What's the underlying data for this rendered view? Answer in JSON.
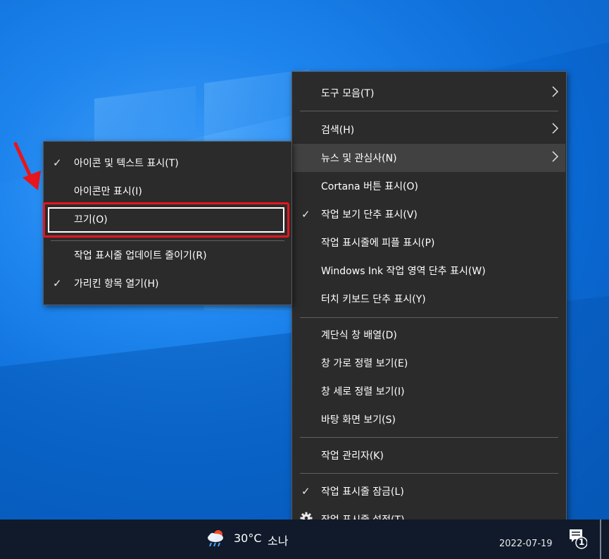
{
  "desktop": {
    "wallpaper": "windows-10-light-beams",
    "accent": "#0b6fd6"
  },
  "main_menu": {
    "items": [
      {
        "label": "도구 모음(T)",
        "submenu": true
      },
      {
        "label": "검색(H)",
        "submenu": true
      },
      {
        "label": "뉴스 및 관심사(N)",
        "submenu": true,
        "highlighted": true
      },
      {
        "label": "Cortana 버튼 표시(O)"
      },
      {
        "label": "작업 보기 단추 표시(V)",
        "checked": true
      },
      {
        "label": "작업 표시줄에 피플 표시(P)"
      },
      {
        "label": "Windows Ink 작업 영역 단추 표시(W)"
      },
      {
        "label": "터치 키보드 단추 표시(Y)"
      },
      {
        "label": "계단식 창 배열(D)"
      },
      {
        "label": "창 가로 정렬 보기(E)"
      },
      {
        "label": "창 세로 정렬 보기(I)"
      },
      {
        "label": "바탕 화면 보기(S)"
      },
      {
        "label": "작업 관리자(K)"
      },
      {
        "label": "작업 표시줄 잠금(L)",
        "checked": true
      },
      {
        "label": "작업 표시줄 설정(T)",
        "icon": "gear-icon"
      }
    ]
  },
  "sub_menu": {
    "items": [
      {
        "label": "아이콘 및 텍스트 표시(T)",
        "checked": true
      },
      {
        "label": "아이콘만 표시(I)"
      },
      {
        "label": "끄기(O)",
        "annotated": true
      },
      {
        "label": "작업 표시줄 업데이트 줄이기(R)"
      },
      {
        "label": "가리킨 항목 열기(H)",
        "checked": true
      }
    ]
  },
  "annotation": {
    "color": "#e8151b",
    "arrow_icon": "red-arrow-icon"
  },
  "taskbar": {
    "weather_icon": "weather-cloud-rain-icon",
    "temperature": "30°C",
    "weather_text": "소나",
    "date": "2022-07-19",
    "notification_count": "1"
  },
  "glyphs": {
    "check": "✓",
    "chevron": "›"
  }
}
